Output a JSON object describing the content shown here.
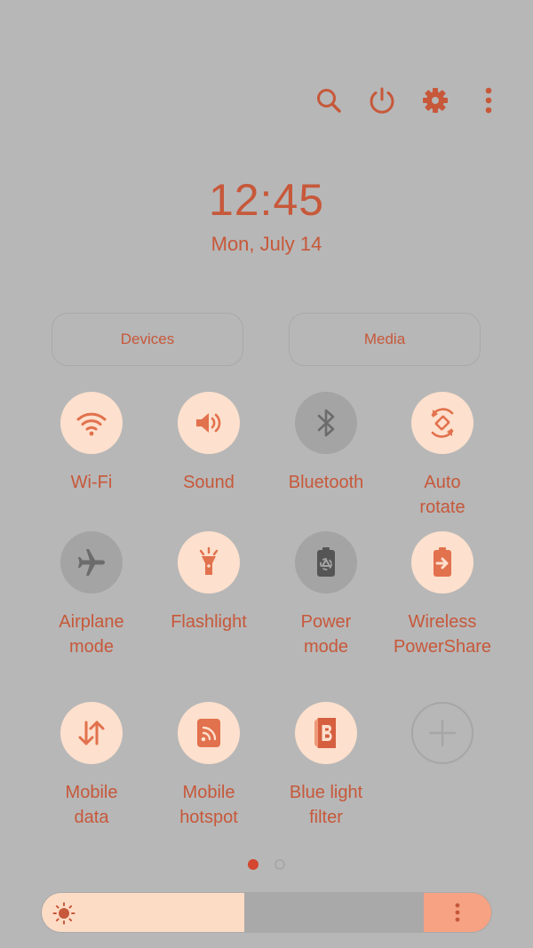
{
  "topbar": {
    "icons": [
      "search-icon",
      "power-icon",
      "gear-icon",
      "more-vertical-icon"
    ]
  },
  "clock": {
    "time": "12:45",
    "date": "Mon, July 14"
  },
  "buttons": {
    "devices": "Devices",
    "media": "Media"
  },
  "tiles": [
    {
      "id": "wifi",
      "label": "Wi-Fi",
      "state": "on",
      "icon": "wifi-icon"
    },
    {
      "id": "sound",
      "label": "Sound",
      "state": "on",
      "icon": "speaker-icon"
    },
    {
      "id": "bluetooth",
      "label": "Bluetooth",
      "state": "off",
      "icon": "bluetooth-icon"
    },
    {
      "id": "auto-rotate",
      "label": "Auto\nrotate",
      "state": "on",
      "icon": "auto-rotate-icon"
    },
    {
      "id": "airplane",
      "label": "Airplane\nmode",
      "state": "off",
      "icon": "airplane-icon"
    },
    {
      "id": "flashlight",
      "label": "Flashlight",
      "state": "on",
      "icon": "flashlight-icon"
    },
    {
      "id": "power-mode",
      "label": "Power\nmode",
      "state": "off",
      "icon": "battery-recycle-icon"
    },
    {
      "id": "powershare",
      "label": "Wireless\nPowerShare",
      "state": "on",
      "icon": "battery-share-icon"
    },
    {
      "id": "mobile-data",
      "label": "Mobile\ndata",
      "state": "on",
      "icon": "up-down-arrows-icon"
    },
    {
      "id": "hotspot",
      "label": "Mobile\nhotspot",
      "state": "on",
      "icon": "hotspot-icon"
    },
    {
      "id": "blue-light",
      "label": "Blue light\nfilter",
      "state": "on",
      "icon": "blue-light-filter-icon"
    },
    {
      "id": "add",
      "label": "",
      "state": "add",
      "icon": "plus-icon"
    }
  ],
  "pagination": {
    "current": 1,
    "total": 2
  },
  "brightness": {
    "level": 0.45
  },
  "colors": {
    "accent": "#c7583a",
    "tile_on": "#fde0cd",
    "tile_off": "#a4a4a4",
    "background": "#b7b7b7"
  }
}
